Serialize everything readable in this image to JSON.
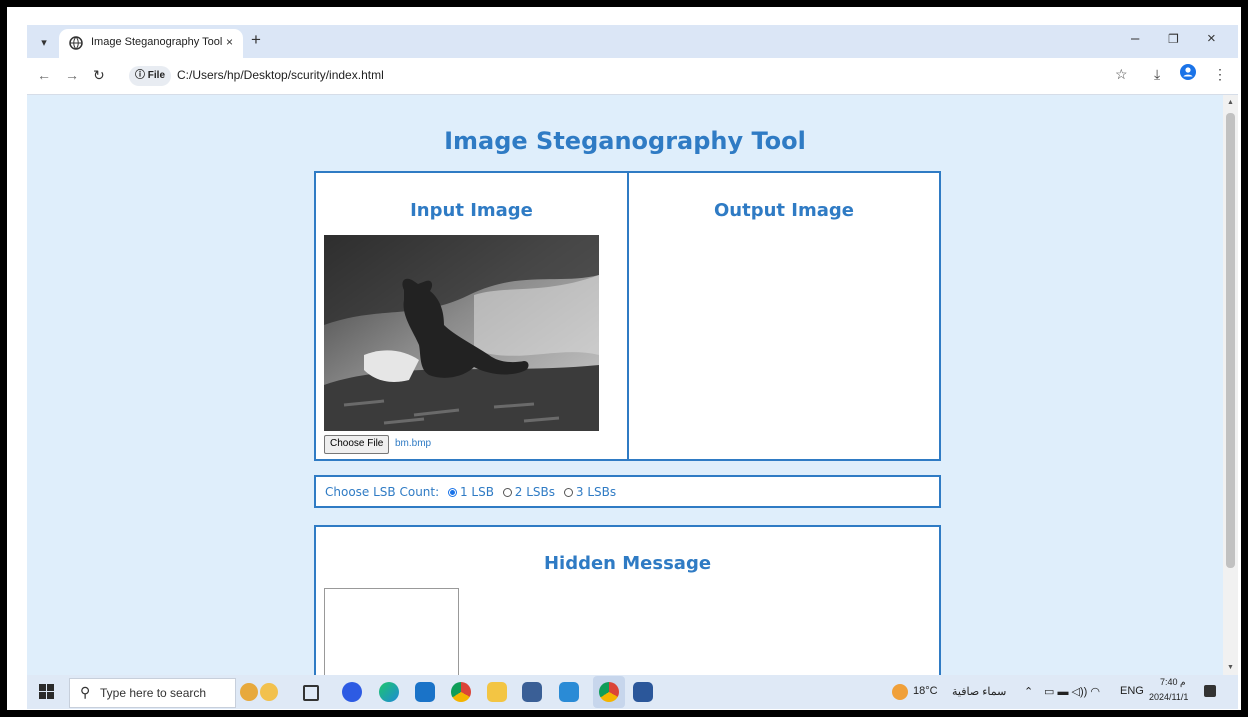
{
  "browser": {
    "tab_title": "Image Steganography Tool",
    "tab_close": "×",
    "new_tab": "+",
    "chip_label": "File",
    "url": "C:/Users/hp/Desktop/scurity/index.html",
    "window_controls": [
      "–",
      "❐",
      "×"
    ]
  },
  "page": {
    "title": "Image Steganography Tool",
    "input_panel": {
      "heading": "Input Image",
      "button_label": "Choose File",
      "file_name": "bm.bmp"
    },
    "output_panel": {
      "heading": "Output Image"
    },
    "lsb": {
      "label": "Choose LSB Count:",
      "options": [
        {
          "label": "1 LSB",
          "selected": true
        },
        {
          "label": "2 LSBs",
          "selected": false
        },
        {
          "label": "3 LSBs",
          "selected": false
        }
      ]
    },
    "hidden_message": {
      "heading": "Hidden Message"
    }
  },
  "taskbar": {
    "search_placeholder": "Type here to search",
    "weather_temp": "18°C",
    "weather_text": "سماء صافية",
    "language": "ENG",
    "time": "7:40 م",
    "date": "2024/11/1"
  },
  "colors": {
    "accent": "#2f7bc4",
    "page_bg": "#dfeefb"
  }
}
